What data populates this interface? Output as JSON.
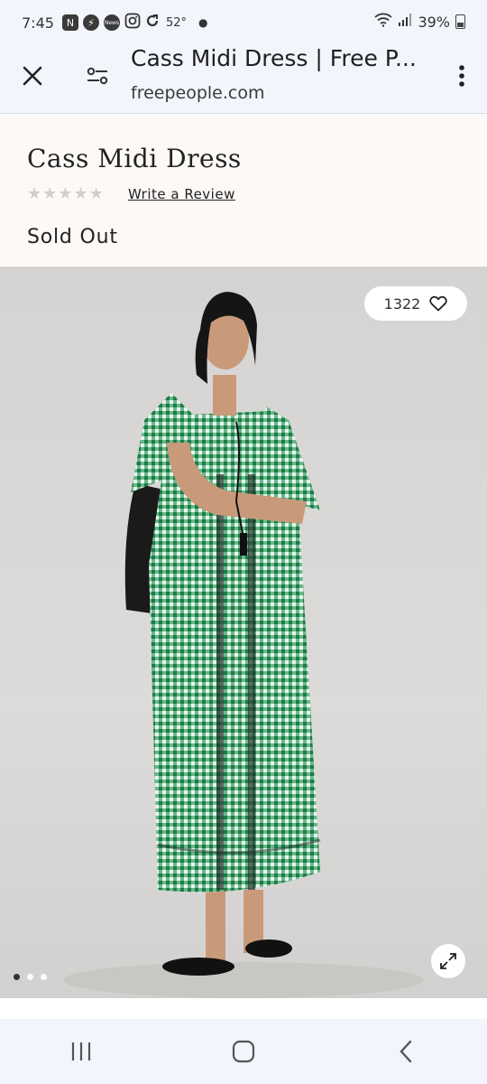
{
  "status_bar": {
    "time": "7:45",
    "temperature": "52°",
    "battery": "39%",
    "icons": [
      "n-app-icon",
      "bolt-app-icon",
      "news-app-icon",
      "instagram-icon",
      "refresh-app-icon",
      "wifi-icon",
      "signal-icon",
      "battery-icon"
    ],
    "news_label": "News"
  },
  "browser": {
    "title": "Cass Midi Dress | Free P...",
    "domain": "freepeople.com"
  },
  "product": {
    "name": "Cass Midi Dress",
    "rating_stars": 0,
    "write_review": "Write a Review",
    "availability": "Sold Out",
    "favorites_count": "1322",
    "image_count": 3,
    "active_image": 1
  },
  "colors": {
    "dress_green": "#2f9a5d",
    "background_cream": "#fcf9f7",
    "browser_bar": "#f2f5fb"
  }
}
